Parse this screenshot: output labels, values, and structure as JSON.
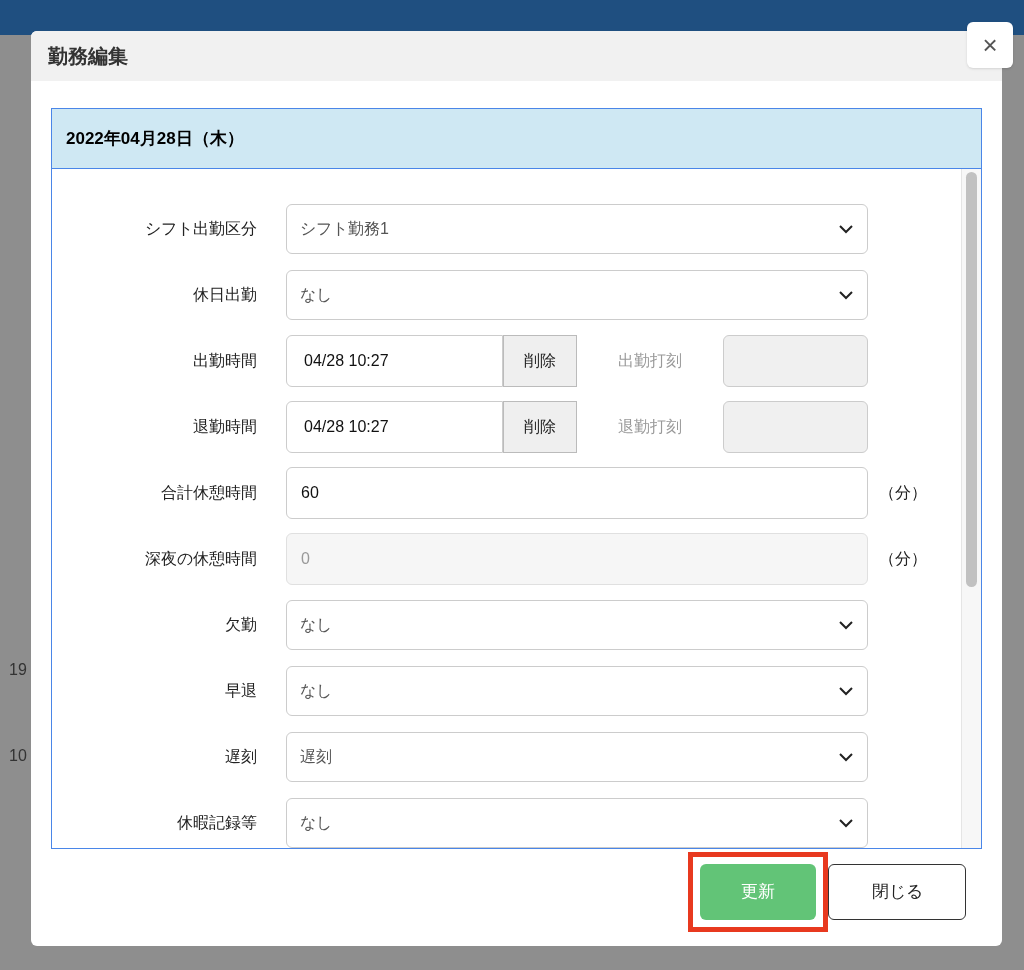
{
  "background_rows": [
    "19",
    "10"
  ],
  "dialog": {
    "title": "勤務編集",
    "close": "×",
    "date": "2022年04月28日（木）",
    "fields": [
      {
        "kind": "select",
        "label": "シフト出勤区分",
        "value": "シフト勤務1"
      },
      {
        "kind": "select",
        "label": "休日出勤",
        "value": "なし"
      },
      {
        "kind": "time",
        "label": "出勤時間",
        "value": "04/28 10:27",
        "button": "削除",
        "stamp_label": "出勤打刻"
      },
      {
        "kind": "time",
        "label": "退勤時間",
        "value": "04/28 10:27",
        "button": "削除",
        "stamp_label": "退勤打刻"
      },
      {
        "kind": "number",
        "label": "合計休憩時間",
        "value": "60",
        "unit": "（分）",
        "disabled": false
      },
      {
        "kind": "number",
        "label": "深夜の休憩時間",
        "value": "0",
        "unit": "（分）",
        "disabled": true
      },
      {
        "kind": "select",
        "label": "欠勤",
        "value": "なし"
      },
      {
        "kind": "select",
        "label": "早退",
        "value": "なし"
      },
      {
        "kind": "select",
        "label": "遅刻",
        "value": "遅刻"
      },
      {
        "kind": "select",
        "label": "休暇記録等",
        "value": "なし"
      }
    ],
    "buttons": [
      {
        "label": "更新",
        "kind": "primary",
        "highlighted": true
      },
      {
        "label": "閉じる",
        "kind": "secondary",
        "highlighted": false
      }
    ]
  }
}
